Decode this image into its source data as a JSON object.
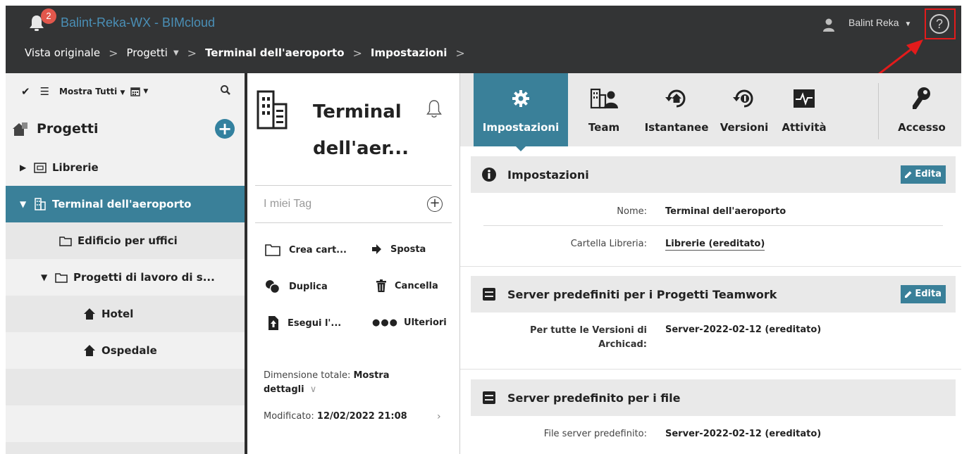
{
  "header": {
    "app_title": "Balint-Reka-WX - BIMcloud",
    "notification_count": "2",
    "user_name": "Balint Reka",
    "help_label": "?",
    "breadcrumb": [
      "Vista originale",
      "Progetti",
      "Terminal dell'aeroporto",
      "Impostazioni"
    ]
  },
  "sidebar": {
    "filter_label": "Mostra Tutti",
    "projects_title": "Progetti",
    "add_label": "+",
    "tree": [
      {
        "label": "Librerie"
      },
      {
        "label": "Terminal dell'aeroporto"
      },
      {
        "label": "Edificio per uffici"
      },
      {
        "label": "Progetti di lavoro di s..."
      },
      {
        "label": "Hotel"
      },
      {
        "label": "Ospedale"
      }
    ]
  },
  "project": {
    "title_line1": "Terminal",
    "title_line2": "dell'aer...",
    "tags_label": "I miei Tag",
    "tags_add": "+",
    "actions": {
      "create_folder": "Crea cart...",
      "move": "Sposta",
      "duplicate": "Duplica",
      "delete": "Cancella",
      "export": "Esegui l'...",
      "more": "Ulteriori"
    },
    "size_label": "Dimensione totale:",
    "size_value": "Mostra dettagli",
    "size_chevron": "∨",
    "modified_label": "Modificato:",
    "modified_value": "12/02/2022 21:08",
    "modified_chevron": "›"
  },
  "tabs": [
    {
      "label": "Impostazioni",
      "icon": "gear-icon"
    },
    {
      "label": "Team",
      "icon": "team-icon"
    },
    {
      "label": "Istantanee",
      "icon": "snapshot-icon"
    },
    {
      "label": "Versioni",
      "icon": "versions-icon"
    },
    {
      "label": "Attività",
      "icon": "activity-icon"
    },
    {
      "label": "Accesso",
      "icon": "key-icon"
    }
  ],
  "sections": {
    "settings": {
      "title": "Impostazioni",
      "edit": "Edita",
      "name_label": "Nome:",
      "name_value": "Terminal dell'aeroporto",
      "library_label": "Cartella Libreria:",
      "library_value": "Librerie (ereditato)"
    },
    "teamwork": {
      "title": "Server predefiniti per i Progetti Teamwork",
      "edit": "Edita",
      "versions_label": "Per tutte le Versioni di Archicad:",
      "versions_value": "Server-2022-02-12 (ereditato)"
    },
    "files": {
      "title": "Server predefinito per i file",
      "file_label": "File server predefinito:",
      "file_value": "Server-2022-02-12 (ereditato)"
    }
  },
  "colors": {
    "accent": "#3a8099",
    "header_bg": "#333435",
    "title_link": "#4a8fb6",
    "highlight": "#e31b1b"
  }
}
